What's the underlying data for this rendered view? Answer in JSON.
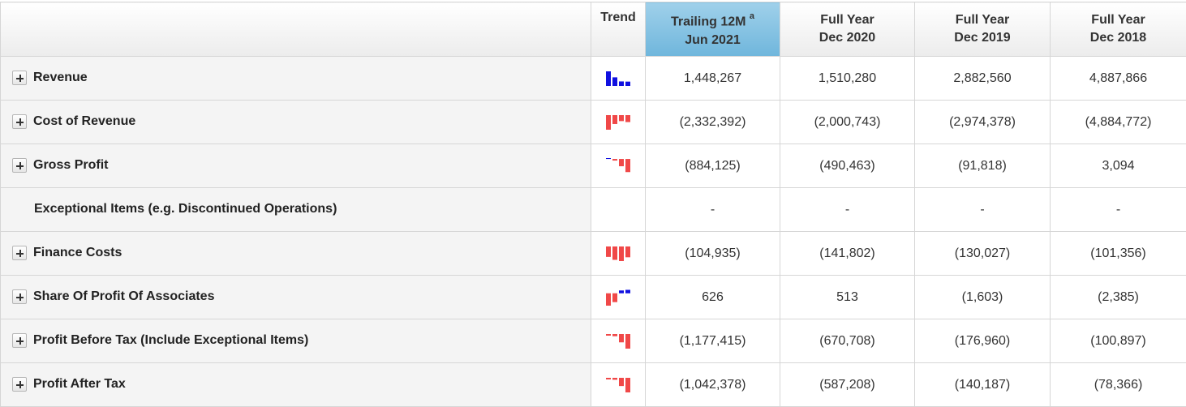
{
  "header": {
    "trend_label": "Trend",
    "columns": [
      {
        "line1": "Trailing 12M",
        "sup": "a",
        "line2": "Jun 2021",
        "active": true
      },
      {
        "line1": "Full Year",
        "sup": "",
        "line2": "Dec 2020",
        "active": false
      },
      {
        "line1": "Full Year",
        "sup": "",
        "line2": "Dec 2019",
        "active": false
      },
      {
        "line1": "Full Year",
        "sup": "",
        "line2": "Dec 2018",
        "active": false
      }
    ]
  },
  "colors": {
    "positive": "#1010e0",
    "negative": "#f04848"
  },
  "rows": [
    {
      "name": "revenue",
      "label": "Revenue",
      "expandable": true,
      "values": [
        "1,448,267",
        "1,510,280",
        "2,882,560",
        "4,887,866"
      ],
      "trend": [
        4887866,
        2882560,
        1510280,
        1448267
      ]
    },
    {
      "name": "cost-of-revenue",
      "label": "Cost of Revenue",
      "expandable": true,
      "values": [
        "(2,332,392)",
        "(2,000,743)",
        "(2,974,378)",
        "(4,884,772)"
      ],
      "trend": [
        -4884772,
        -2974378,
        -2000743,
        -2332392
      ]
    },
    {
      "name": "gross-profit",
      "label": "Gross Profit",
      "expandable": true,
      "values": [
        "(884,125)",
        "(490,463)",
        "(91,818)",
        "3,094"
      ],
      "trend": [
        3094,
        -91818,
        -490463,
        -884125
      ]
    },
    {
      "name": "exceptional-items",
      "label": "Exceptional Items (e.g. Discontinued Operations)",
      "expandable": false,
      "values": [
        "-",
        "-",
        "-",
        "-"
      ],
      "trend": []
    },
    {
      "name": "finance-costs",
      "label": "Finance Costs",
      "expandable": true,
      "values": [
        "(104,935)",
        "(141,802)",
        "(130,027)",
        "(101,356)"
      ],
      "trend": [
        -101356,
        -130027,
        -141802,
        -104935
      ]
    },
    {
      "name": "share-of-profit-of-associates",
      "label": "Share Of Profit Of Associates",
      "expandable": true,
      "values": [
        "626",
        "513",
        "(1,603)",
        "(2,385)"
      ],
      "trend": [
        -2385,
        -1603,
        513,
        626
      ]
    },
    {
      "name": "profit-before-tax",
      "label": "Profit Before Tax (Include Exceptional Items)",
      "expandable": true,
      "values": [
        "(1,177,415)",
        "(670,708)",
        "(176,960)",
        "(100,897)"
      ],
      "trend": [
        -100897,
        -176960,
        -670708,
        -1177415
      ]
    },
    {
      "name": "profit-after-tax",
      "label": "Profit After Tax",
      "expandable": true,
      "values": [
        "(1,042,378)",
        "(587,208)",
        "(140,187)",
        "(78,366)"
      ],
      "trend": [
        -78366,
        -140187,
        -587208,
        -1042378
      ]
    }
  ]
}
